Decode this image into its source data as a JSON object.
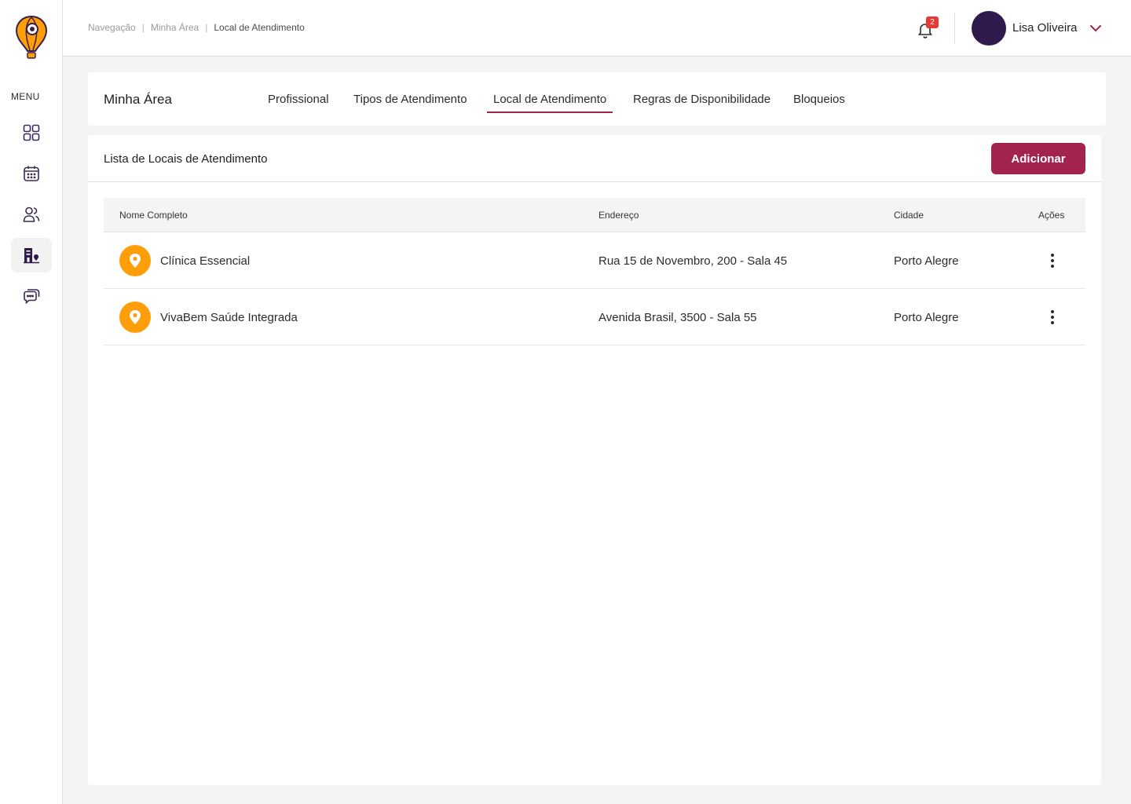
{
  "sidebar": {
    "menu_label": "MENU",
    "items": [
      {
        "icon": "dashboard-grid-icon"
      },
      {
        "icon": "calendar-icon"
      },
      {
        "icon": "users-icon"
      },
      {
        "icon": "building-location-icon",
        "active": true
      },
      {
        "icon": "chat-icon"
      }
    ]
  },
  "header": {
    "breadcrumb": [
      "Navegação",
      "Minha Área",
      "Local de Atendimento"
    ],
    "notifications_count": "2",
    "user_name": "Lisa Oliveira"
  },
  "tabs_section": {
    "title": "Minha Área",
    "tabs": [
      {
        "label": "Profissional"
      },
      {
        "label": "Tipos de Atendimento"
      },
      {
        "label": "Local de Atendimento",
        "active": true
      },
      {
        "label": "Regras de Disponibilidade"
      },
      {
        "label": "Bloqueios"
      }
    ]
  },
  "list": {
    "title": "Lista de Locais de Atendimento",
    "add_label": "Adicionar",
    "columns": [
      "Nome Completo",
      "Endereço",
      "Cidade",
      "Ações"
    ],
    "rows": [
      {
        "name": "Clínica Essencial",
        "address": "Rua 15 de Novembro, 200 - Sala 45",
        "city": "Porto Alegre"
      },
      {
        "name": "VivaBem Saúde Integrada",
        "address": "Avenida Brasil, 3500 - Sala 55",
        "city": "Porto Alegre"
      }
    ]
  },
  "colors": {
    "accent": "#a3234f",
    "pin": "#ff9e0b",
    "avatar": "#2e1a4d",
    "badge": "#e53935"
  }
}
